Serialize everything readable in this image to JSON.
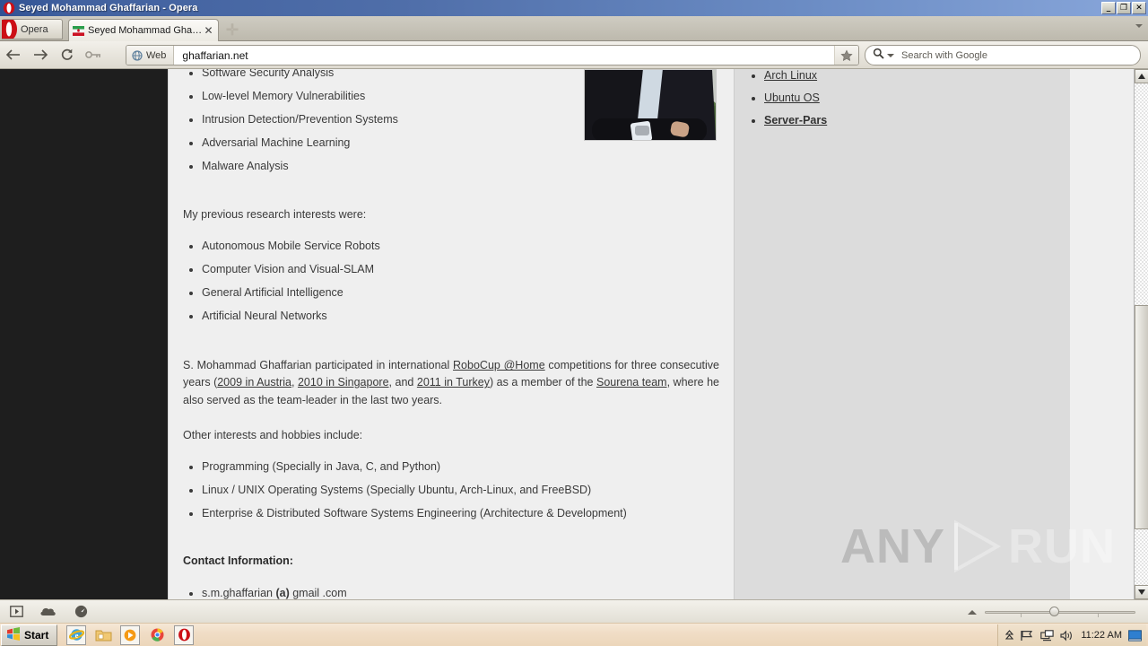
{
  "window": {
    "title": "Seyed Mohammad Ghaffarian - Opera",
    "minimize_label": "_",
    "restore_label": "❐",
    "close_label": "✕"
  },
  "browser": {
    "opera_button_label": "Opera",
    "tab": {
      "title": "Seyed Mohammad Ghaff...",
      "close_label": "✕",
      "favicon_name": "iran-flag-favicon"
    },
    "new_tab_label": "✛",
    "nav": {
      "back_icon": "back-arrow-icon",
      "forward_icon": "forward-arrow-icon",
      "reload_icon": "reload-icon",
      "password_icon": "key-icon"
    },
    "address": {
      "web_badge_label": "Web",
      "url": "ghaffarian.net",
      "bookmark_icon": "star-icon"
    },
    "search": {
      "placeholder": "Search with Google",
      "engine_icon": "magnifier-icon"
    }
  },
  "page": {
    "research_list_top": [
      "Software Security Analysis",
      "Low-level Memory Vulnerabilities",
      "Intrusion Detection/Prevention Systems",
      "Adversarial Machine Learning",
      "Malware Analysis"
    ],
    "previous_intro": "My previous research interests were:",
    "previous_list": [
      "Autonomous Mobile Service Robots",
      "Computer Vision and Visual-SLAM",
      "General Artificial Intelligence",
      "Artificial Neural Networks"
    ],
    "robocup_paragraph": {
      "part1": "S. Mohammad Ghaffarian participated in international ",
      "link_robocup": "RoboCup @Home",
      "part2": " competitions for three consecutive years (",
      "link_2009": "2009 in Austria",
      "part3": ", ",
      "link_2010": "2010 in Singapore",
      "part4": ", and ",
      "link_2011": "2011 in Turkey",
      "part5": ") as a member of the ",
      "link_sourena": "Sourena team",
      "part6": ", where he also served as the team-leader in the last two years."
    },
    "other_intro": "Other interests and hobbies include:",
    "other_list": [
      "Programming (Specially in Java, C, and Python)",
      "Linux / UNIX Operating Systems (Specially Ubuntu, Arch-Linux, and FreeBSD)",
      "Enterprise & Distributed Software Systems Engineering (Architecture & Development)"
    ],
    "contact_heading": "Contact Information:",
    "email": {
      "user": "s.m.ghaffarian ",
      "at": "(a)",
      "domain": " gmail .com"
    },
    "photo_alt": "portrait-photo"
  },
  "sidebar": {
    "links": [
      {
        "label": "Arch Linux",
        "bold": false
      },
      {
        "label": "Ubuntu OS",
        "bold": false
      },
      {
        "label": "Server-Pars",
        "bold": true
      }
    ]
  },
  "watermark": {
    "left_text": "ANY",
    "right_text": "RUN",
    "icon_name": "play-triangle-icon"
  },
  "statusbar": {
    "icons": [
      "panel-toggle-icon",
      "cloud-icon",
      "turbo-speedometer-icon"
    ],
    "zoom_collapse_icon": "zoom-collapse-icon"
  },
  "taskbar": {
    "start_label": "Start",
    "quick_launch": [
      "internet-explorer-icon",
      "folder-icon",
      "media-player-icon",
      "chrome-icon",
      "opera-icon"
    ],
    "tray_icons": [
      "show-hidden-icons-icon",
      "flag-security-icon",
      "network-icon",
      "volume-icon"
    ],
    "clock": "11:22 AM",
    "desktop_icon": "show-desktop-icon"
  },
  "colors": {
    "titlebar_start": "#2f5193",
    "titlebar_end": "#88a6da",
    "page_bg": "#efefef",
    "sidebar_bg": "#dcdcdc",
    "viewport_dark": "#1e1e1e",
    "taskbar_bg": "#ecd6ba",
    "opera_red": "#cc0f16"
  }
}
